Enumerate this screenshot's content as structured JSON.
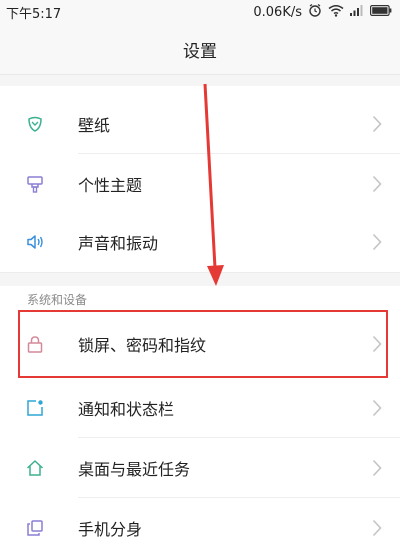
{
  "status_bar": {
    "time": "下午5:17",
    "network_speed": "0.06K/s",
    "icons": [
      "alarm-icon",
      "wifi-icon",
      "signal-icon",
      "battery-icon"
    ]
  },
  "header": {
    "title": "设置"
  },
  "sections": [
    {
      "items": [
        {
          "label": "壁纸",
          "icon": "wallpaper-icon",
          "icon_color": "#3bb08f"
        },
        {
          "label": "个性主题",
          "icon": "theme-icon",
          "icon_color": "#8a7fd6"
        },
        {
          "label": "声音和振动",
          "icon": "sound-icon",
          "icon_color": "#3a8fdd"
        }
      ]
    },
    {
      "title": "系统和设备",
      "items": [
        {
          "label": "锁屏、密码和指纹",
          "icon": "lock-icon",
          "icon_color": "#d4899a",
          "highlighted": true
        },
        {
          "label": "通知和状态栏",
          "icon": "notification-icon",
          "icon_color": "#2ea6d6"
        },
        {
          "label": "桌面与最近任务",
          "icon": "home-icon",
          "icon_color": "#3bb08f"
        },
        {
          "label": "手机分身",
          "icon": "clone-icon",
          "icon_color": "#8a7fd6"
        }
      ]
    }
  ],
  "annotation": {
    "highlight_color": "#e53935"
  }
}
